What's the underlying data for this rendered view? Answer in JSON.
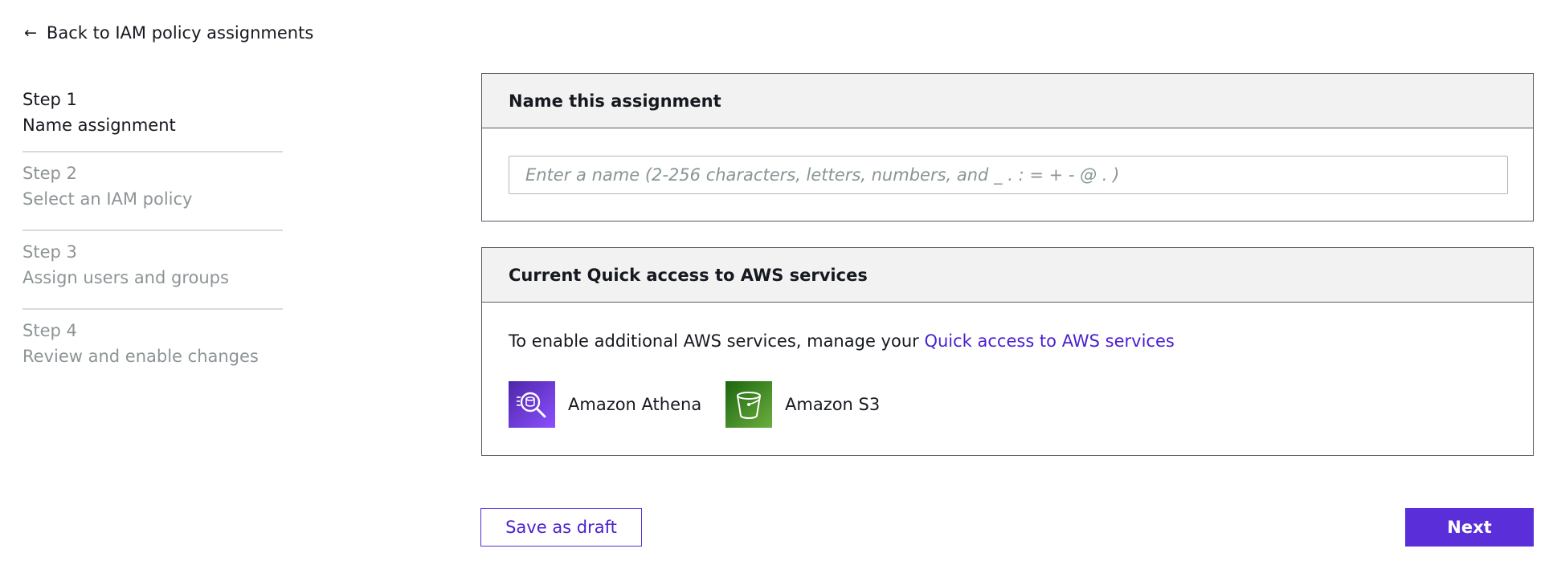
{
  "back_link": {
    "label": "Back to IAM policy assignments",
    "icon": "arrow-left-icon"
  },
  "steps": [
    {
      "number": "Step 1",
      "title": "Name assignment",
      "state": "active"
    },
    {
      "number": "Step 2",
      "title": "Select an IAM policy",
      "state": "inactive"
    },
    {
      "number": "Step 3",
      "title": "Assign users and groups",
      "state": "inactive"
    },
    {
      "number": "Step 4",
      "title": "Review and enable changes",
      "state": "inactive"
    }
  ],
  "name_panel": {
    "title": "Name this assignment",
    "input_value": "",
    "input_placeholder": "Enter a name (2-256 characters, letters, numbers, and _ . : = + - @ . )"
  },
  "services_panel": {
    "title": "Current Quick access to AWS services",
    "description": "To enable additional AWS services, manage your ",
    "link_label": "Quick access to AWS services",
    "services": [
      {
        "name": "Amazon Athena",
        "icon": "amazon-athena-icon",
        "color": "#6b3ae8"
      },
      {
        "name": "Amazon S3",
        "icon": "amazon-s3-icon",
        "color": "#3f8624"
      }
    ]
  },
  "actions": {
    "save_draft_label": "Save as draft",
    "next_label": "Next"
  },
  "colors": {
    "accent": "#5a2fd9",
    "link": "#4a1fd1",
    "inactive_text": "#8d9496"
  }
}
